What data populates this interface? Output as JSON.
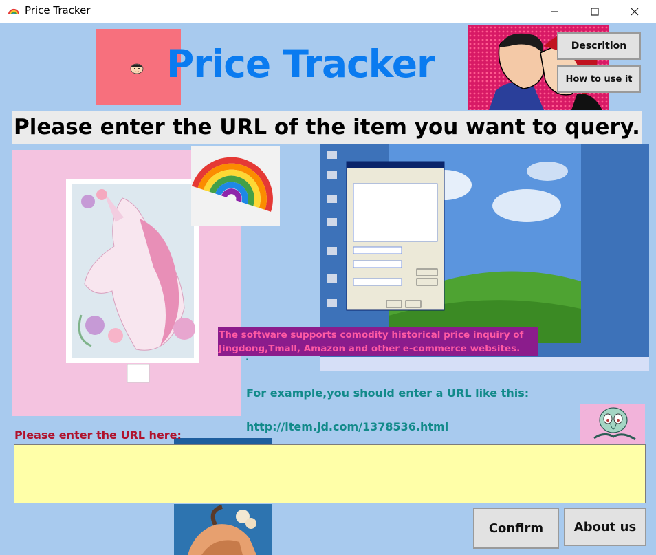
{
  "window": {
    "title": "Price Tracker",
    "minimize_symbol": "—",
    "maximize_symbol": "☐",
    "close_symbol": "✕"
  },
  "header": {
    "title": "Price Tracker",
    "title_color": "#0a7bf0"
  },
  "buttons": {
    "description": "Descrition",
    "how_to_use": "How to use it",
    "confirm": "Confirm",
    "about": "About us"
  },
  "prompt": "Please enter the URL of the item you want to query.",
  "info": {
    "line1": "The software supports comodity historical price inquiry of",
    "line2": "Jingdong,Tmall, Amazon and other e-commerce websites.",
    "dot": "."
  },
  "example": {
    "label": "For example,you should enter a URL like this:",
    "url": "http://item.jd.com/1378536.html"
  },
  "url_field": {
    "label": "Please enter the URL here:",
    "value": "",
    "placeholder": ""
  },
  "colors": {
    "background": "#a8caee",
    "input_background": "#ffffa8",
    "label_red": "#b0122c",
    "teal_text": "#128a8a",
    "info_box": "#8b1c8c",
    "info_text": "#ff5aa4"
  },
  "images": [
    "crayon-shin-chan-icon",
    "pop-art-kiss-image",
    "unicorn-painting-image",
    "rainbow-image",
    "windows-xp-screenshot-image",
    "squidward-image",
    "vintage-woman-image"
  ]
}
